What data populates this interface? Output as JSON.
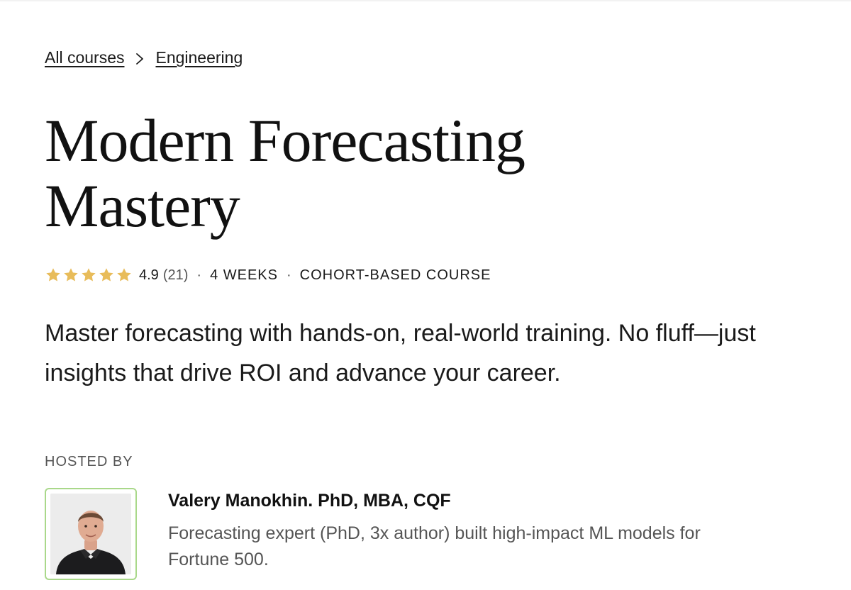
{
  "breadcrumb": {
    "items": [
      "All courses",
      "Engineering"
    ]
  },
  "course": {
    "title": "Modern Forecasting Mastery",
    "rating": "4.9",
    "rating_count": "(21)",
    "rating_stars": 5,
    "duration": "4 WEEKS",
    "format": "COHORT-BASED COURSE",
    "separator": "·",
    "description": "Master forecasting with hands-on, real-world training. No fluff—just insights that drive ROI and advance your career."
  },
  "host_section": {
    "label": "HOSTED BY",
    "name": "Valery Manokhin. PhD, MBA, CQF",
    "bio": "Forecasting expert (PhD, 3x author) built high-impact ML models for Fortune 500."
  },
  "colors": {
    "star": "#E8BC5A",
    "avatar_border": "#A9D88A",
    "text": "#1A1A1A",
    "muted": "#555555"
  },
  "icons": {
    "star": "star-icon",
    "chevron": "chevron-right-icon"
  }
}
